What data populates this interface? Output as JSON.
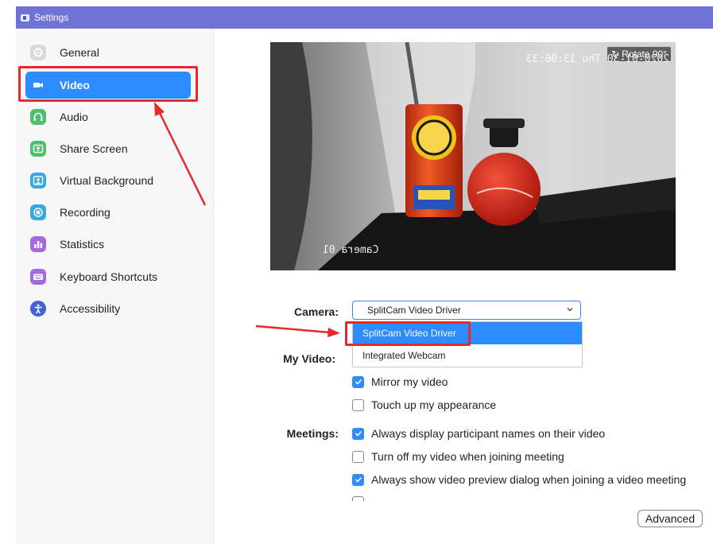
{
  "window": {
    "title": "Settings"
  },
  "sidebar": {
    "items": [
      {
        "label": "General",
        "icon": "gear-icon",
        "color": "#d6d6d6"
      },
      {
        "label": "Video",
        "icon": "video-camera-icon",
        "color": "#ffffff",
        "active": true
      },
      {
        "label": "Audio",
        "icon": "headphones-icon",
        "color": "#4fbf6f"
      },
      {
        "label": "Share Screen",
        "icon": "share-screen-icon",
        "color": "#4fbf6f"
      },
      {
        "label": "Virtual Background",
        "icon": "person-frame-icon",
        "color": "#35a9e0"
      },
      {
        "label": "Recording",
        "icon": "record-icon",
        "color": "#35a9e0"
      },
      {
        "label": "Statistics",
        "icon": "bar-chart-icon",
        "color": "#a36ae0"
      },
      {
        "label": "Keyboard Shortcuts",
        "icon": "keyboard-icon",
        "color": "#a36ae0"
      },
      {
        "label": "Accessibility",
        "icon": "accessibility-icon",
        "color": "#3e64d6"
      }
    ]
  },
  "preview": {
    "rotate_label": "Rotate 90°",
    "osd_date": "2020-01-30 Thu 13:06:33",
    "osd_camera": "Camera 01"
  },
  "camera": {
    "label": "Camera:",
    "selected": "SplitCam Video Driver",
    "options": [
      "SplitCam Video Driver",
      "Integrated Webcam"
    ]
  },
  "my_video": {
    "label": "My Video:",
    "options": [
      {
        "label": "Mirror my video",
        "checked": true
      },
      {
        "label": "Touch up my appearance",
        "checked": false
      }
    ]
  },
  "meetings": {
    "label": "Meetings:",
    "options": [
      {
        "label": "Always display participant names on their video",
        "checked": true
      },
      {
        "label": "Turn off my video when joining meeting",
        "checked": false
      },
      {
        "label": "Always show video preview dialog when joining a video meeting",
        "checked": true
      }
    ]
  },
  "advanced_label": "Advanced",
  "colors": {
    "accent": "#2d8cff",
    "titlebar": "#7072d8",
    "annotation": "#e8282a"
  }
}
